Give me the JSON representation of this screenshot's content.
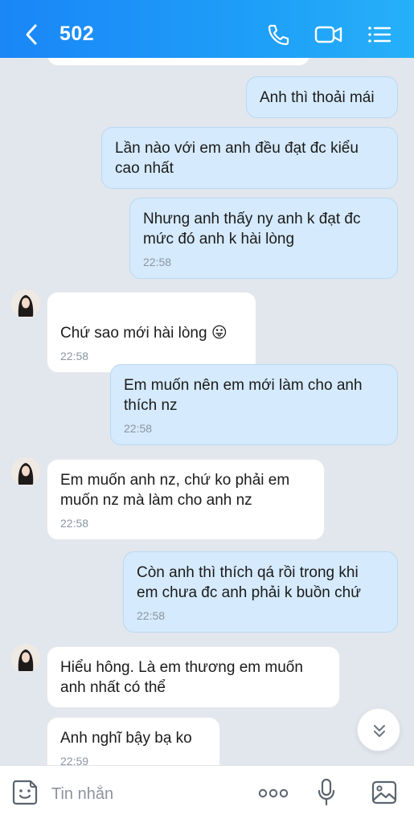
{
  "header": {
    "title": "502",
    "icons": [
      "back-icon",
      "phone-icon",
      "video-call-icon",
      "menu-list-icon"
    ]
  },
  "messages": [
    {
      "direction": "in",
      "text": "",
      "time": ""
    },
    {
      "direction": "out",
      "text": "Anh thì thoải mái",
      "time": ""
    },
    {
      "direction": "out",
      "text": "Lần nào với em anh đều đạt đc kiểu\ncao nhất",
      "time": ""
    },
    {
      "direction": "out",
      "text": "Nhưng anh thấy ny anh k đạt đc\nmức đó anh k hài lòng",
      "time": "22:58"
    },
    {
      "direction": "in",
      "text": "Chứ sao mới hài lòng",
      "emoji": "😛",
      "time": "22:58"
    },
    {
      "direction": "out",
      "text": "Em muốn nên em mới làm cho anh\nthích nz",
      "time": "22:58"
    },
    {
      "direction": "in",
      "text": "Em muốn anh nz, chứ ko phải em\nmuốn nz mà làm cho anh nz",
      "time": "22:58"
    },
    {
      "direction": "out",
      "text": "Còn anh thì thích qá rồi trong khi\nem chưa đc anh phải k buồn chứ",
      "time": "22:58"
    },
    {
      "direction": "in",
      "text": "Hiểu hông. Là em thương em muốn\nanh nhất có thể",
      "time": ""
    },
    {
      "direction": "in",
      "text": "Anh nghĩ bậy bạ ko",
      "time": "22:59"
    }
  ],
  "composer": {
    "placeholder": "Tin nhắn",
    "icons": [
      "sticker-icon",
      "more-options-icon",
      "microphone-icon",
      "image-gallery-icon"
    ]
  },
  "colors": {
    "header_gradient_start": "#1a86f7",
    "header_gradient_end": "#26b0f9",
    "outgoing_bubble": "#d5eafc",
    "incoming_bubble": "#ffffff",
    "chat_background": "#e2e6ed"
  }
}
